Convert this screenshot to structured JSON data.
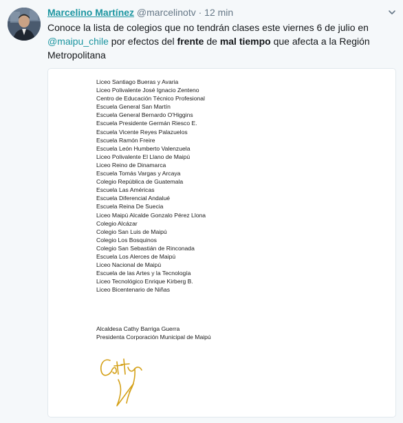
{
  "author": {
    "name": "Marcelino Martínez",
    "handle": "@marcelinotv",
    "separator": "·",
    "time": "12 min"
  },
  "tweet": {
    "t1": "Conoce la lista de colegios que no tendrán clases este viernes 6 de julio en ",
    "mention": "@maipu_chile",
    "t2": " por efectos del ",
    "bold1": "frente",
    "t3": " de ",
    "bold2": "mal tiempo",
    "t4": "  que afecta a la Región Metropolitana"
  },
  "document": {
    "schools": [
      "Liceo Santiago Bueras y Avaria",
      "Liceo Polivalente José Ignacio Zenteno",
      "Centro de Educación Técnico Profesional",
      "Escuela General San Martín",
      "Escuela General Bernardo O'Higgins",
      "Escuela Presidente Germán Riesco E.",
      "Escuela Vicente Reyes Palazuelos",
      "Escuela  Ramón Freire",
      "Escuela León Humberto Valenzuela",
      "Liceo Polivalente El Llano de Maipú",
      "Liceo Reino de Dinamarca",
      "Escuela Tomás Vargas y Arcaya",
      "Colegio  República de Guatemala",
      "Escuela Las Américas",
      "Escuela Diferencial Andalué",
      "Escuela  Reina De Suecia",
      "Liceo Maipú Alcalde Gonzalo Pérez Llona",
      "Colegio  Alcázar",
      "Colegio  San Luis de Maipú",
      "Colegio Los Bosquinos",
      "Colegio San Sebastián de Rinconada",
      "Escuela  Los Alerces de Maipú",
      "Liceo Nacional de Maipú",
      "Escuela de las Artes y la Tecnología",
      "Liceo Tecnológico Enrique Kirberg B.",
      "Liceo Bicentenario de Niñas"
    ],
    "signer_name": "Alcaldesa Cathy Barriga Guerra",
    "signer_title": "Presidenta Corporación Municipal de Maipú",
    "signature_text": "Cathy"
  },
  "colors": {
    "link": "#1b95a0",
    "muted": "#657786",
    "background": "#f5f8fa",
    "signature_ink": "#d4a017"
  },
  "icons": {
    "caret": "chevron-down-icon"
  }
}
